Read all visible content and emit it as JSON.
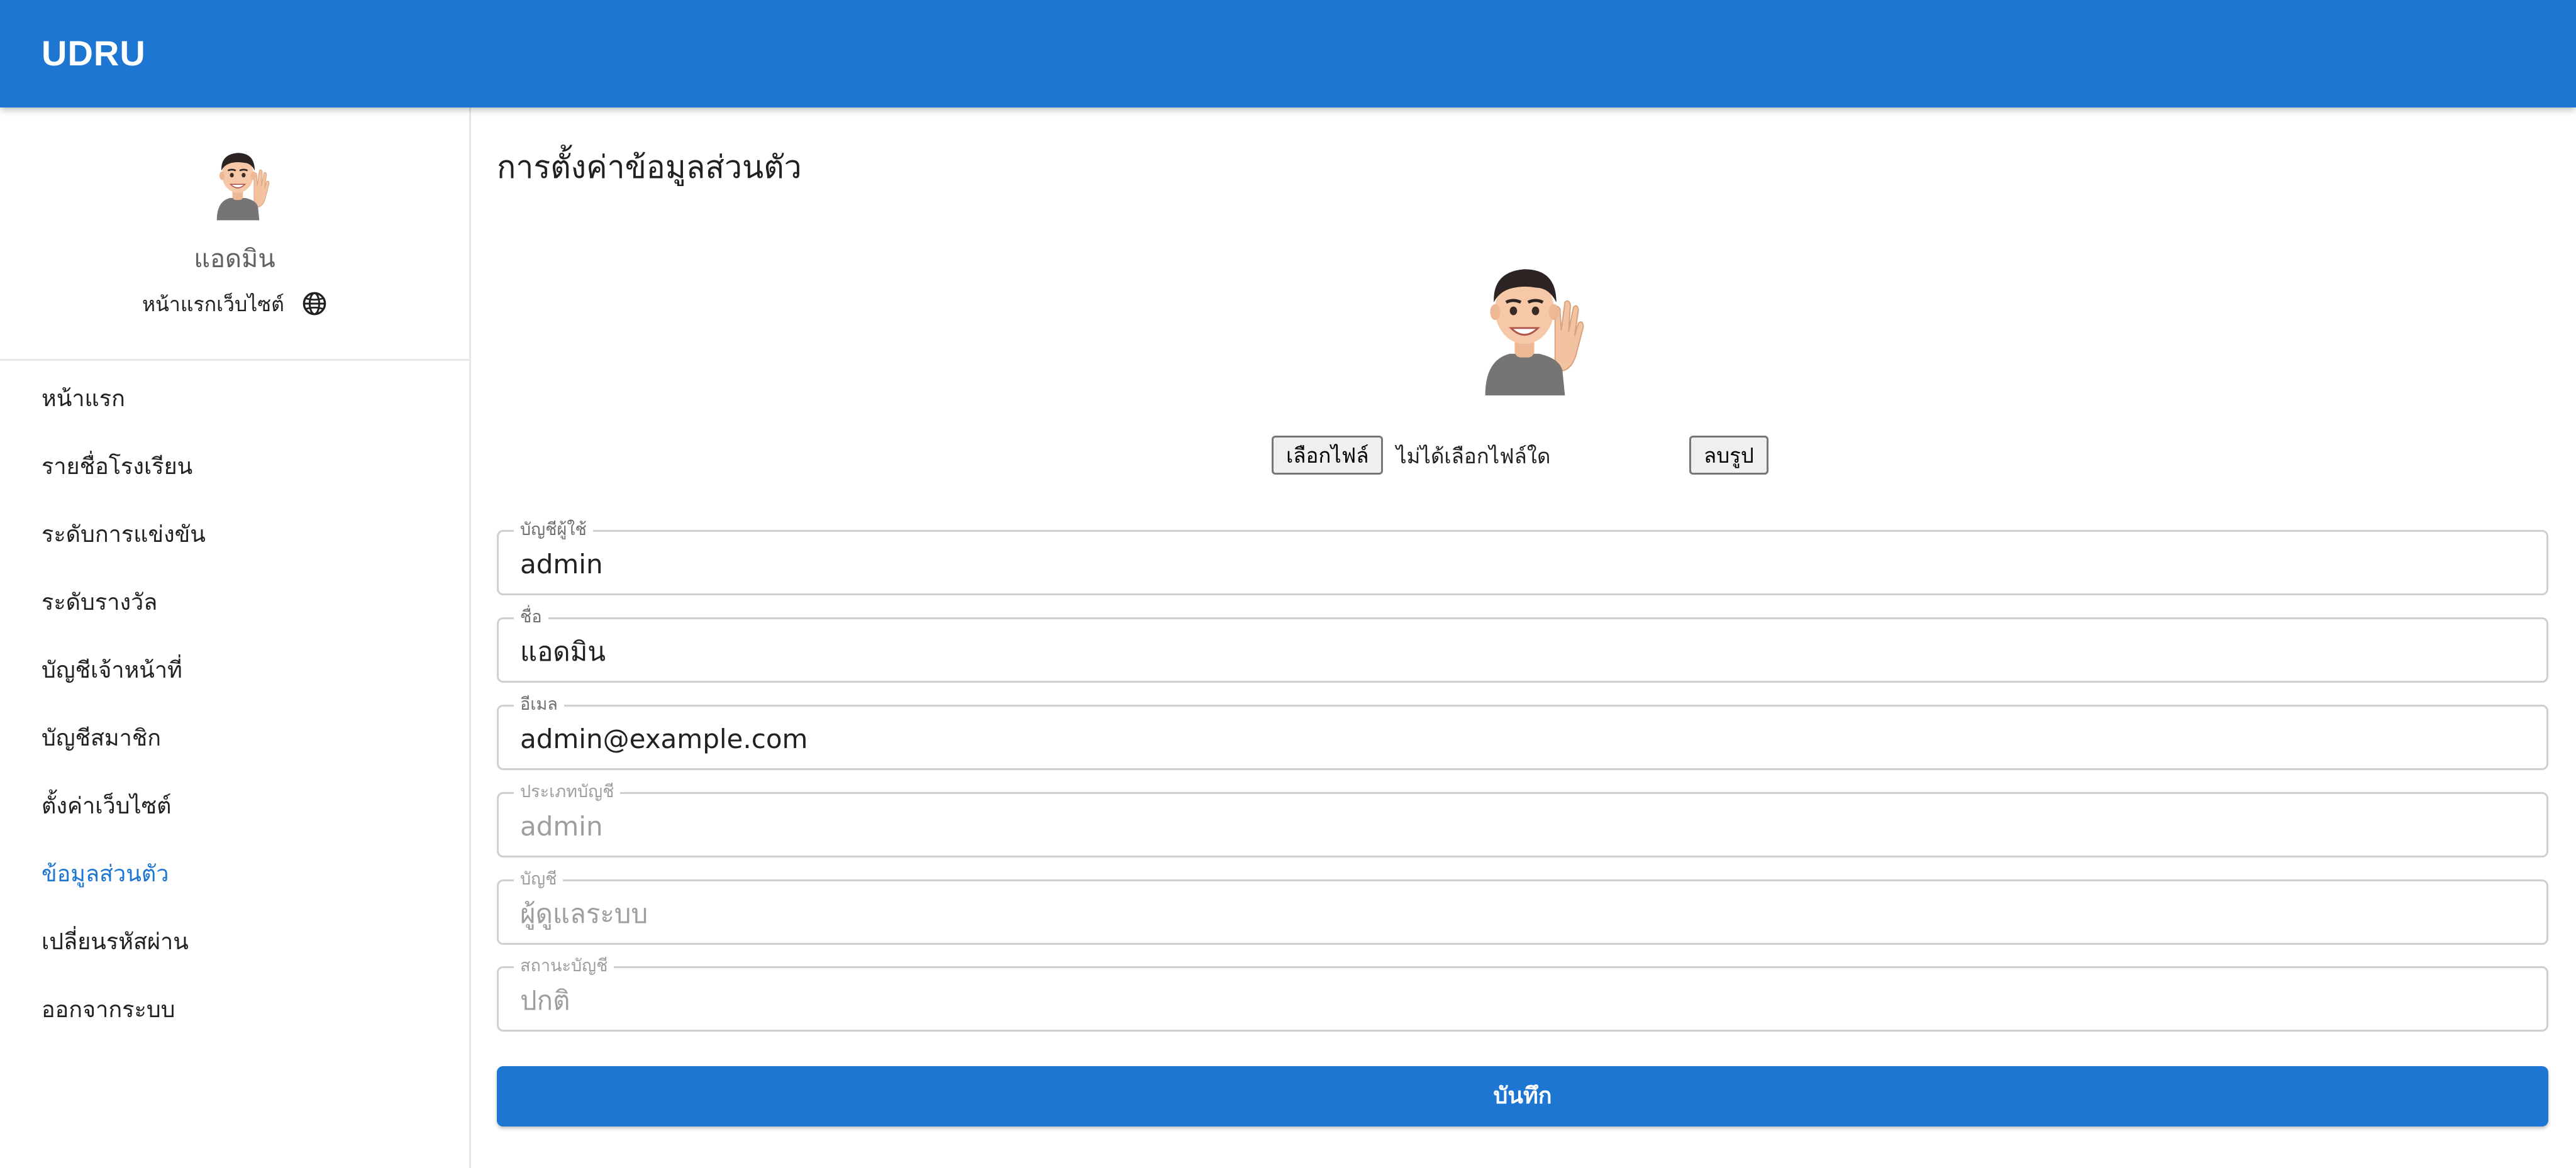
{
  "app": {
    "brand": "UDRU"
  },
  "sidebar": {
    "profile_name": "แอดมิน",
    "home_link": "หน้าแรกเว็บไซต์",
    "home_link_icon": "globe-icon",
    "items": [
      {
        "label": "หน้าแรก"
      },
      {
        "label": "รายชื่อโรงเรียน"
      },
      {
        "label": "ระดับการแข่งขัน"
      },
      {
        "label": "ระดับรางวัล"
      },
      {
        "label": "บัญชีเจ้าหน้าที่"
      },
      {
        "label": "บัญชีสมาชิก"
      },
      {
        "label": "ตั้งค่าเว็บไซต์"
      },
      {
        "label": "ข้อมูลส่วนตัว",
        "active": true
      },
      {
        "label": "เปลี่ยนรหัสผ่าน"
      },
      {
        "label": "ออกจากระบบ"
      }
    ]
  },
  "main": {
    "title": "การตั้งค่าข้อมูลส่วนตัว",
    "upload": {
      "choose_file_label": "เลือกไฟล์",
      "no_file_label": "ไม่ได้เลือกไฟล์ใด",
      "remove_label": "ลบรูป"
    },
    "fields": {
      "username": {
        "label": "บัญชีผู้ใช้",
        "value": "admin"
      },
      "name": {
        "label": "ชื่อ",
        "value": "แอดมิน"
      },
      "email": {
        "label": "อีเมล",
        "value": "admin@example.com"
      },
      "account_type": {
        "label": "ประเภทบัญชี",
        "value": "admin"
      },
      "account": {
        "label": "บัญชี",
        "value": "ผู้ดูแลระบบ"
      },
      "account_status": {
        "label": "สถานะบัญชี",
        "value": "ปกติ"
      }
    },
    "save_label": "บันทึก"
  },
  "colors": {
    "primary": "#1c76d2",
    "active_menu": "#1c76d2",
    "disabled_text": "#9e9e9e"
  }
}
